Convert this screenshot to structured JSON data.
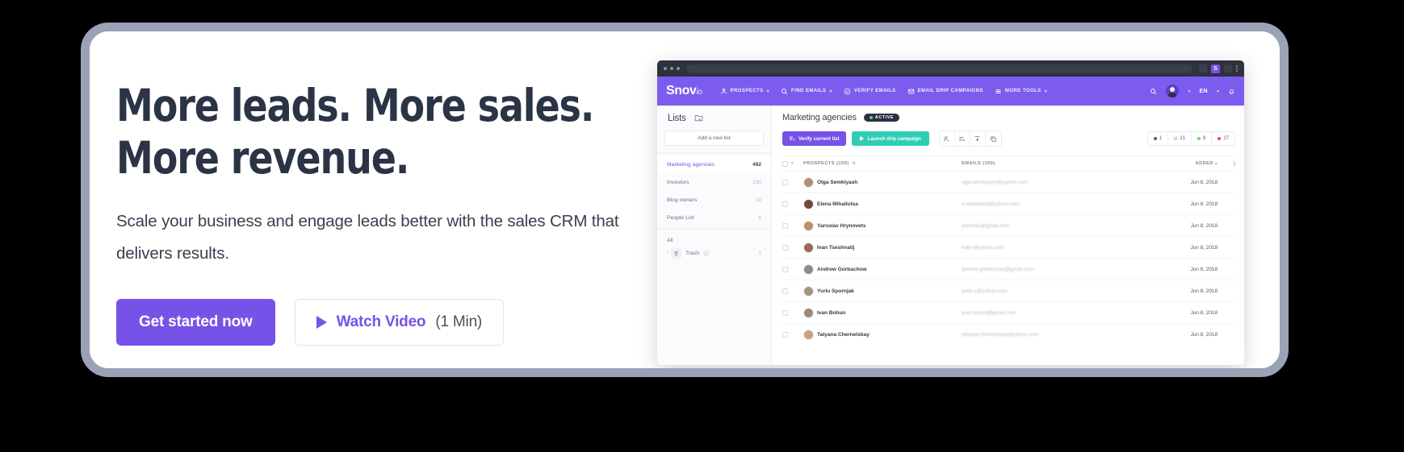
{
  "hero": {
    "title": "More leads. More sales.\nMore revenue.",
    "subtitle": "Scale your business and engage leads better with the sales CRM that delivers results.",
    "primary_cta": "Get started now",
    "video_cta": "Watch Video",
    "video_duration": "(1 Min)",
    "accent_color": "#7652E8"
  },
  "app": {
    "chrome": {
      "extension_badge": "S"
    },
    "navbar": {
      "logo_main": "Snov",
      "logo_suffix": "io",
      "items": [
        {
          "label": "PROSPECTS",
          "icon": "person-icon",
          "caret": true
        },
        {
          "label": "FIND EMAILS",
          "icon": "search-icon",
          "caret": true
        },
        {
          "label": "VERIFY EMAILS",
          "icon": "check-circle-icon",
          "caret": false
        },
        {
          "label": "EMAIL DRIP CAMPAIGNS",
          "icon": "envelope-icon",
          "caret": false
        },
        {
          "label": "MORE TOOLS",
          "icon": "hamburger-icon",
          "caret": true
        }
      ],
      "language": "EN",
      "bg_color": "#7C5CEF"
    },
    "sidebar": {
      "title": "Lists",
      "add_button": "Add a new list",
      "lists": [
        {
          "label": "Marketing agencies",
          "count": "492",
          "active": true
        },
        {
          "label": "Investors",
          "count": "230",
          "active": false
        },
        {
          "label": "Blog owners",
          "count": "10",
          "active": false
        },
        {
          "label": "People List",
          "count": "6",
          "active": false
        }
      ],
      "all_label": "All",
      "trash_label": "Trash",
      "trash_count": "1"
    },
    "main": {
      "title": "Marketing agencies",
      "status_badge": "ACTIVE",
      "verify_button": "Verify current list",
      "launch_button": "Launch drip campaign",
      "stats": [
        {
          "value": "1",
          "color": "#55596A",
          "style": "solid"
        },
        {
          "value": "21",
          "color": "#C2C6D2",
          "style": "hollow"
        },
        {
          "value": "8",
          "color": "#6CD66F",
          "style": "solid"
        },
        {
          "value": "17",
          "color": "#EE4B4B",
          "style": "solid"
        }
      ],
      "table": {
        "columns": {
          "prospects": "PROSPECTS (100)",
          "emails": "EMAILS (100)",
          "added": "ADDED"
        },
        "sort_column": "ADDED",
        "sort_direction": "asc",
        "rows": [
          {
            "name": "Olga Semkiyash",
            "email": "olga.semkiyash@yahoo.com",
            "added": "Jun 8, 2018",
            "avatar": "#B98C78"
          },
          {
            "name": "Elena Mihailutsa",
            "email": "e.mihailutsa@yahoo.com",
            "added": "Jun 8, 2018",
            "avatar": "#6F4B3C"
          },
          {
            "name": "Yaroslav Hrynovets",
            "email": "yaroslav@gmail.com",
            "added": "Jun 8, 2018",
            "avatar": "#C08F63"
          },
          {
            "name": "Ivan Tseshnatij",
            "email": "ivan.t@yahoo.com",
            "added": "Jun 8, 2018",
            "avatar": "#9A6B52"
          },
          {
            "name": "Andrew Gorbachow",
            "email": "andrew.gorbachow@gmail.com",
            "added": "Jun 8, 2018",
            "avatar": "#8C8C8C"
          },
          {
            "name": "Yuriu Spornjak",
            "email": "yuriu.s@yahoo.com",
            "added": "Jun 8, 2018",
            "avatar": "#A39484"
          },
          {
            "name": "Ivan Bohun",
            "email": "ivan.bohun@gmail.com",
            "added": "Jun 8, 2018",
            "avatar": "#9D8B7A"
          },
          {
            "name": "Tatyana Chernetskay",
            "email": "tatyana.chernetskay@yahoo.com",
            "added": "Jun 8, 2018",
            "avatar": "#C9A184"
          }
        ]
      }
    }
  }
}
